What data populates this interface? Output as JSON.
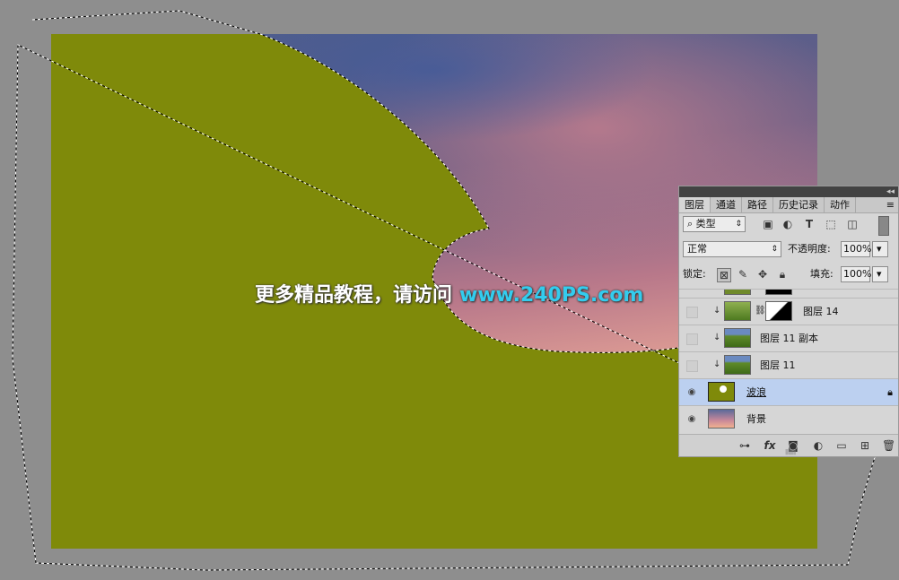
{
  "watermark": {
    "text": "更多精品教程，请访问",
    "url": "www.240PS.com"
  },
  "colors": {
    "canvas_fill": "#7f8a0a",
    "workspace": "#8e8e8e",
    "selected_layer": "#bcd0f0"
  },
  "layers_panel": {
    "tabs": [
      "图层",
      "通道",
      "路径",
      "历史记录",
      "动作"
    ],
    "filter": {
      "label": "类型",
      "search_icon": "search-icon"
    },
    "blend_mode": "正常",
    "opacity_label": "不透明度:",
    "opacity_value": "100%",
    "lock_label": "锁定:",
    "fill_label": "填充:",
    "fill_value": "100%",
    "layers": [
      {
        "name": "图层 14",
        "visible": false,
        "clipped": true,
        "has_mask": true
      },
      {
        "name": "图层 11 副本",
        "visible": false,
        "clipped": true
      },
      {
        "name": "图层 11",
        "visible": false,
        "clipped": true
      },
      {
        "name": "波浪",
        "visible": true,
        "selected": true,
        "locked": true
      },
      {
        "name": "背景",
        "visible": true
      }
    ]
  }
}
